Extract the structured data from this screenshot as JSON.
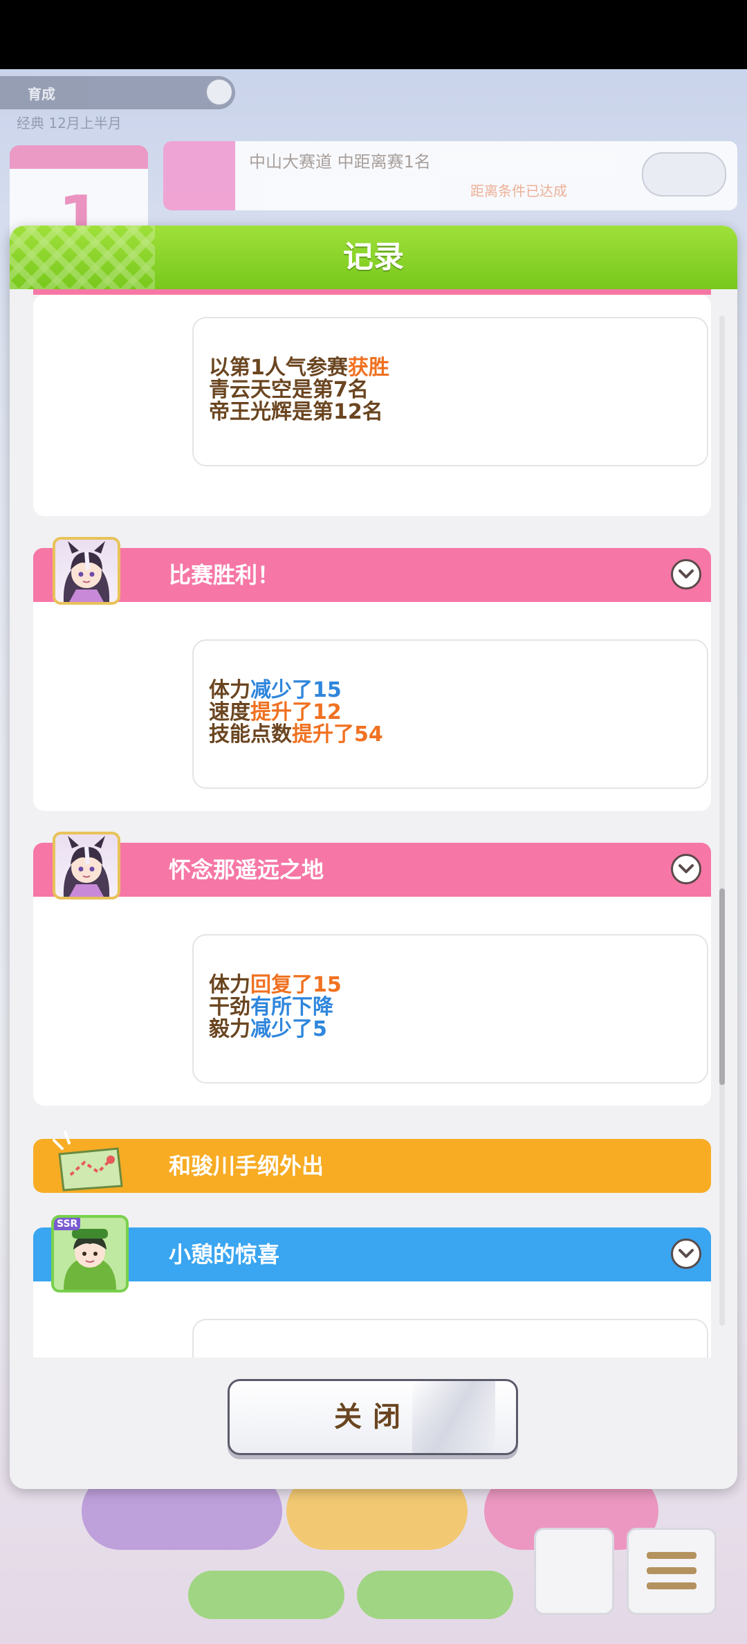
{
  "background": {
    "top_left_label": "育成",
    "subtitle": "经典 12月上半月",
    "banner_text": "中山大赛道 中距离赛1名",
    "banner_sub": "距离条件已达成"
  },
  "modal": {
    "title": "记录",
    "close_label": "关闭"
  },
  "entries": [
    {
      "lines": [
        [
          {
            "t": "以第1人气参赛",
            "c": "n"
          },
          {
            "t": "获胜",
            "c": "o"
          }
        ],
        [
          {
            "t": "青云天空是第7名",
            "c": "n"
          }
        ],
        [
          {
            "t": "帝王光辉是第12名",
            "c": "n"
          }
        ]
      ]
    },
    {
      "title": "比赛胜利！",
      "lines": [
        [
          {
            "t": "体力",
            "c": "n"
          },
          {
            "t": "减少了15",
            "c": "b"
          }
        ],
        [
          {
            "t": "速度",
            "c": "n"
          },
          {
            "t": "提升了12",
            "c": "o"
          }
        ],
        [
          {
            "t": "技能点数",
            "c": "n"
          },
          {
            "t": "提升了54",
            "c": "o"
          }
        ]
      ]
    },
    {
      "title": "怀念那遥远之地",
      "lines": [
        [
          {
            "t": "体力",
            "c": "n"
          },
          {
            "t": "回复了15",
            "c": "o"
          }
        ],
        [
          {
            "t": "干劲",
            "c": "n"
          },
          {
            "t": "有所下降",
            "c": "b"
          }
        ],
        [
          {
            "t": "毅力",
            "c": "n"
          },
          {
            "t": "减少了5",
            "c": "b"
          }
        ]
      ]
    },
    {
      "title": "和骏川手纲外出"
    },
    {
      "title": "小憩的惊喜",
      "badge": "SSR"
    }
  ],
  "colors": {
    "header_green": "#8ad42c",
    "pink_bar": "#f677a6",
    "orange_bar": "#f7ac24",
    "blue_bar": "#3aa5f0",
    "text_brown": "#6a4520",
    "highlight_orange": "#f07121",
    "highlight_blue": "#2f86dc"
  }
}
